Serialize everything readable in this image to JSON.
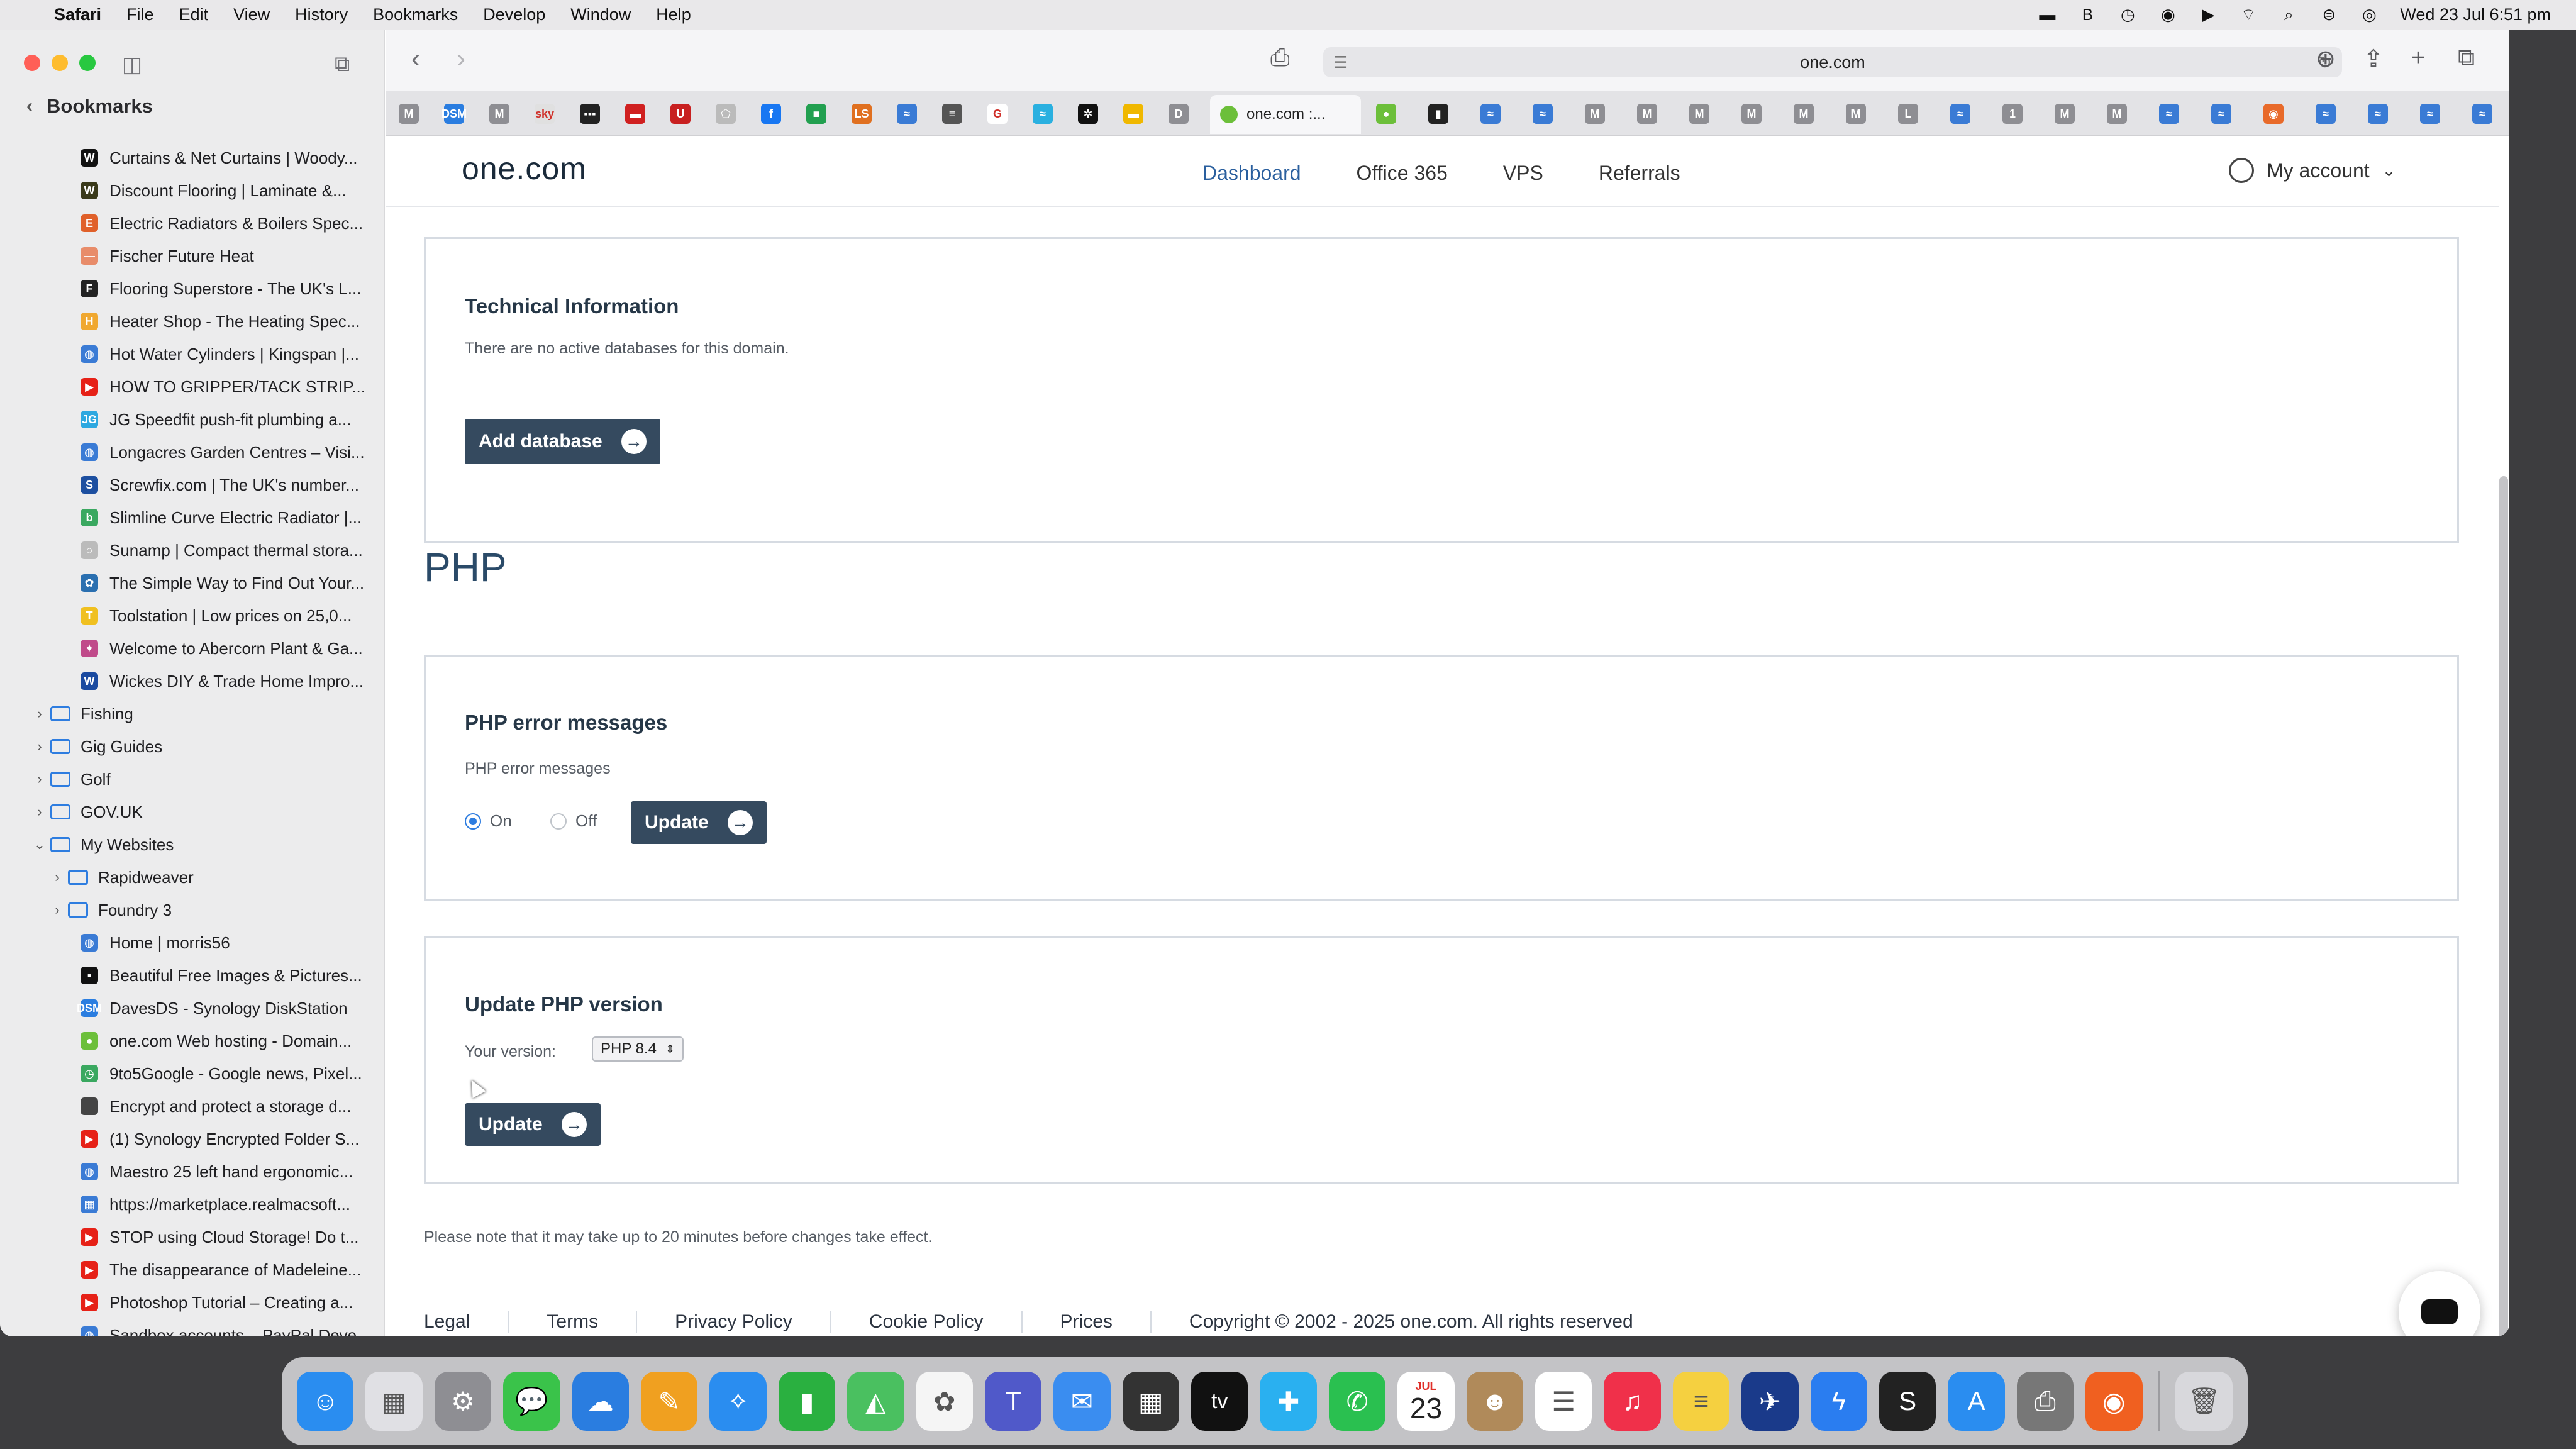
{
  "menubar": {
    "items": [
      "Safari",
      "File",
      "Edit",
      "View",
      "History",
      "Bookmarks",
      "Develop",
      "Window",
      "Help"
    ],
    "clock": "Wed 23 Jul  6:51 pm"
  },
  "sidebar": {
    "title": "Bookmarks",
    "items": [
      {
        "label": "Curtains & Net Curtains | Woody...",
        "fav": "W",
        "color": "#111111",
        "kind": "link"
      },
      {
        "label": "Discount Flooring | Laminate &...",
        "fav": "W",
        "color": "#3a3a1a",
        "kind": "link"
      },
      {
        "label": "Electric Radiators & Boilers Spec...",
        "fav": "E",
        "color": "#e0602a",
        "kind": "link"
      },
      {
        "label": "Fischer Future Heat",
        "fav": "—",
        "color": "#e88c6a",
        "kind": "link"
      },
      {
        "label": "Flooring Superstore - The UK's L...",
        "fav": "F",
        "color": "#222222",
        "kind": "link"
      },
      {
        "label": "Heater Shop - The Heating Spec...",
        "fav": "H",
        "color": "#f0a830",
        "kind": "link"
      },
      {
        "label": "Hot Water Cylinders | Kingspan |...",
        "fav": "◍",
        "color": "#3a7bd5",
        "kind": "link"
      },
      {
        "label": "HOW TO GRIPPER/TACK STRIP...",
        "fav": "▶",
        "color": "#e62117",
        "kind": "link"
      },
      {
        "label": "JG Speedfit push-fit plumbing a...",
        "fav": "JG",
        "color": "#2da8e0",
        "kind": "link"
      },
      {
        "label": "Longacres Garden Centres – Visi...",
        "fav": "◍",
        "color": "#3a7bd5",
        "kind": "link"
      },
      {
        "label": "Screwfix.com | The UK's number...",
        "fav": "S",
        "color": "#1d4fa0",
        "kind": "link"
      },
      {
        "label": "Slimline Curve Electric Radiator |...",
        "fav": "b",
        "color": "#3aa860",
        "kind": "link"
      },
      {
        "label": "Sunamp | Compact thermal stora...",
        "fav": "○",
        "color": "#bbbbbb",
        "kind": "link"
      },
      {
        "label": "The Simple Way to Find Out Your...",
        "fav": "✿",
        "color": "#2a6fb0",
        "kind": "link"
      },
      {
        "label": "Toolstation | Low prices on 25,0...",
        "fav": "T",
        "color": "#f0c020",
        "kind": "link"
      },
      {
        "label": "Welcome to Abercorn Plant & Ga...",
        "fav": "✦",
        "color": "#c04a8a",
        "kind": "link"
      },
      {
        "label": "Wickes DIY & Trade Home Impro...",
        "fav": "W",
        "color": "#1a4aa0",
        "kind": "link"
      },
      {
        "label": "Fishing",
        "kind": "folder",
        "expanded": false
      },
      {
        "label": "Gig Guides",
        "kind": "folder",
        "expanded": false
      },
      {
        "label": "Golf",
        "kind": "folder",
        "expanded": false
      },
      {
        "label": "GOV.UK",
        "kind": "folder",
        "expanded": false
      },
      {
        "label": "My Websites",
        "kind": "folder",
        "expanded": true
      },
      {
        "label": "Rapidweaver",
        "kind": "subfolder"
      },
      {
        "label": "Foundry 3",
        "kind": "subfolder"
      },
      {
        "label": "Home | morris56",
        "fav": "◍",
        "color": "#3a7bd5",
        "kind": "sublink"
      },
      {
        "label": "Beautiful Free Images & Pictures...",
        "fav": "▪",
        "color": "#111111",
        "kind": "sublink"
      },
      {
        "label": "DavesDS - Synology DiskStation",
        "fav": "DSM",
        "color": "#2a7de0",
        "kind": "sublink"
      },
      {
        "label": "one.com Web hosting  -  Domain...",
        "fav": "●",
        "color": "#6cbf3a",
        "kind": "sublink"
      },
      {
        "label": "9to5Google - Google news, Pixel...",
        "fav": "◷",
        "color": "#3aa860",
        "kind": "sublink"
      },
      {
        "label": "Encrypt and protect a storage d...",
        "fav": "",
        "color": "#444444",
        "kind": "sublink"
      },
      {
        "label": "(1) Synology Encrypted Folder S...",
        "fav": "▶",
        "color": "#e62117",
        "kind": "sublink"
      },
      {
        "label": "Maestro 25 left hand ergonomic...",
        "fav": "◍",
        "color": "#3a7bd5",
        "kind": "sublink"
      },
      {
        "label": "https://marketplace.realmacsoft...",
        "fav": "▦",
        "color": "#3a7bd5",
        "kind": "sublink"
      },
      {
        "label": "STOP using Cloud Storage! Do t...",
        "fav": "▶",
        "color": "#e62117",
        "kind": "sublink"
      },
      {
        "label": "The disappearance of Madeleine...",
        "fav": "▶",
        "color": "#e62117",
        "kind": "sublink"
      },
      {
        "label": "Photoshop Tutorial – Creating a...",
        "fav": "▶",
        "color": "#e62117",
        "kind": "sublink"
      },
      {
        "label": "Sandbox accounts – PayPal Deve...",
        "fav": "◍",
        "color": "#3a7bd5",
        "kind": "sublink"
      }
    ]
  },
  "browser": {
    "url": "one.com",
    "active_tab": "one.com :...",
    "tab_icons": [
      {
        "t": "M",
        "c": "#8e8e93"
      },
      {
        "t": "DSM",
        "c": "#2a7de0"
      },
      {
        "t": "M",
        "c": "#8e8e93"
      },
      {
        "t": "sky",
        "c": "#e0e0e0"
      },
      {
        "t": "▪▪▪",
        "c": "#222222"
      },
      {
        "t": "▬",
        "c": "#d02020"
      },
      {
        "t": "U",
        "c": "#c82020"
      },
      {
        "t": "⬠",
        "c": "#bbbbbb"
      },
      {
        "t": "f",
        "c": "#1877f2"
      },
      {
        "t": "■",
        "c": "#22a050"
      },
      {
        "t": "LS",
        "c": "#e07020"
      },
      {
        "t": "≈",
        "c": "#3a7bd5"
      },
      {
        "t": "≡",
        "c": "#555555"
      },
      {
        "t": "G",
        "c": "#ffffff"
      },
      {
        "t": "≈",
        "c": "#2ab0e0"
      },
      {
        "t": "✲",
        "c": "#111111"
      },
      {
        "t": "▬",
        "c": "#f0b800"
      },
      {
        "t": "D",
        "c": "#8e8e93"
      }
    ],
    "tab_icons_right": [
      {
        "t": "●",
        "c": "#6cbf3a"
      },
      {
        "t": "▮",
        "c": "#222222"
      },
      {
        "t": "≈",
        "c": "#3a7bd5"
      },
      {
        "t": "≈",
        "c": "#3a7bd5"
      },
      {
        "t": "M",
        "c": "#8e8e93"
      },
      {
        "t": "M",
        "c": "#8e8e93"
      },
      {
        "t": "M",
        "c": "#8e8e93"
      },
      {
        "t": "M",
        "c": "#8e8e93"
      },
      {
        "t": "M",
        "c": "#8e8e93"
      },
      {
        "t": "M",
        "c": "#8e8e93"
      },
      {
        "t": "L",
        "c": "#8e8e93"
      },
      {
        "t": "≈",
        "c": "#3a7bd5"
      },
      {
        "t": "1",
        "c": "#8e8e93"
      },
      {
        "t": "M",
        "c": "#8e8e93"
      },
      {
        "t": "M",
        "c": "#8e8e93"
      },
      {
        "t": "≈",
        "c": "#3a7bd5"
      },
      {
        "t": "≈",
        "c": "#3a7bd5"
      },
      {
        "t": "◉",
        "c": "#e86a2a"
      },
      {
        "t": "≈",
        "c": "#3a7bd5"
      },
      {
        "t": "≈",
        "c": "#3a7bd5"
      },
      {
        "t": "≈",
        "c": "#3a7bd5"
      },
      {
        "t": "≈",
        "c": "#3a7bd5"
      }
    ]
  },
  "site": {
    "logo": "one.com",
    "nav": [
      "Dashboard",
      "Office 365",
      "VPS",
      "Referrals"
    ],
    "account_label": "My account",
    "tech": {
      "title": "Technical Information",
      "text": "There are no active databases for this domain.",
      "button": "Add database"
    },
    "php_title": "PHP",
    "errors": {
      "title": "PHP error messages",
      "label": "PHP error messages",
      "on_label": "On",
      "off_label": "Off",
      "selected": "On",
      "button": "Update"
    },
    "version": {
      "title": "Update PHP version",
      "label": "Your version:",
      "selected": "PHP 8.4",
      "button": "Update"
    },
    "note": "Please note that it may take up to 20 minutes before changes take effect.",
    "footer": {
      "links": [
        "Legal",
        "Terms",
        "Privacy Policy",
        "Cookie Policy",
        "Prices"
      ],
      "copyright": "Copyright © 2002 - 2025 one.com. All rights reserved"
    }
  },
  "dock": {
    "calendar_month": "JUL",
    "calendar_day": "23",
    "tv_label": "tv",
    "apps": [
      {
        "name": "finder",
        "c": "#2a8df0",
        "g": "☺"
      },
      {
        "name": "launchpad",
        "c": "#e0e0e4",
        "g": "▦"
      },
      {
        "name": "system-settings",
        "c": "#8e8e93",
        "g": "⚙"
      },
      {
        "name": "messages",
        "c": "#3ac34a",
        "g": "💬"
      },
      {
        "name": "icloud",
        "c": "#2a7de0",
        "g": "☁"
      },
      {
        "name": "pages",
        "c": "#f0a020",
        "g": "✎"
      },
      {
        "name": "safari",
        "c": "#2a8df0",
        "g": "✧"
      },
      {
        "name": "numbers",
        "c": "#2ab040",
        "g": "▮"
      },
      {
        "name": "maps",
        "c": "#4ac060",
        "g": "◭"
      },
      {
        "name": "photos",
        "c": "#f5f5f5",
        "g": "✿"
      },
      {
        "name": "teams",
        "c": "#5059c9",
        "g": "T"
      },
      {
        "name": "mail",
        "c": "#3a8df0",
        "g": "✉"
      },
      {
        "name": "calculator",
        "c": "#333333",
        "g": "▦"
      },
      {
        "name": "apple-tv",
        "c": "#111111",
        "g": "tv"
      },
      {
        "name": "xcode-cloud",
        "c": "#2ab0f0",
        "g": "✚"
      },
      {
        "name": "whatsapp",
        "c": "#2ac050",
        "g": "✆"
      },
      {
        "name": "calendar",
        "c": "#ffffff",
        "g": "23"
      },
      {
        "name": "contacts",
        "c": "#b08a5a",
        "g": "☻"
      },
      {
        "name": "reminders",
        "c": "#ffffff",
        "g": "☰"
      },
      {
        "name": "music",
        "c": "#f0304a",
        "g": "♫"
      },
      {
        "name": "notes",
        "c": "#f5d040",
        "g": "≡"
      },
      {
        "name": "rapidweaver",
        "c": "#1a3a8a",
        "g": "✈"
      },
      {
        "name": "messenger",
        "c": "#2a7df0",
        "g": "ϟ"
      },
      {
        "name": "setapp",
        "c": "#222222",
        "g": "S"
      },
      {
        "name": "app-store",
        "c": "#2a8df0",
        "g": "A"
      },
      {
        "name": "printer",
        "c": "#777777",
        "g": "⎙"
      },
      {
        "name": "firefox",
        "c": "#f06020",
        "g": "◉"
      },
      {
        "name": "trash",
        "c": "#d8d8dc",
        "g": "🗑"
      }
    ]
  }
}
